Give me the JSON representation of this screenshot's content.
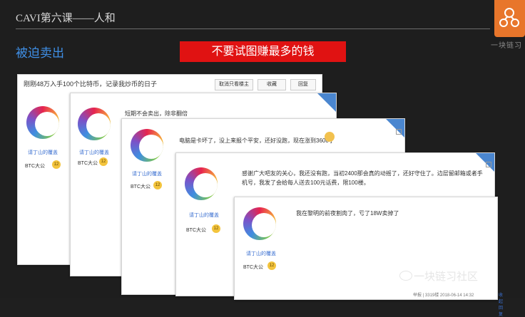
{
  "header": {
    "title": "CAVI第六课——人和",
    "subtitle": "被迫卖出",
    "banner": "不要试图赚最多的钱",
    "logo_text": "一块链习"
  },
  "card1": {
    "title": "刚刚48万入手100个比特币，记录我炒币的日子",
    "buttons": [
      "取消只看楼主",
      "收藏",
      "回复"
    ],
    "user": "请丁山的覆盖",
    "tag": "BTC大公",
    "level": "12"
  },
  "card2": {
    "post": "短期不会卖出，除非翻倍",
    "user": "请丁山的覆盖",
    "tag": "BTC大公",
    "level": "12"
  },
  "card3": {
    "post": "电脑是卡坏了，没上来报个平安，还好没跑，现在涨到3600了",
    "user": "请丁山的覆盖",
    "tag": "BTC大公",
    "level": "12"
  },
  "card4": {
    "post": "感谢广大吧友的关心，我还没有跑，当初2400那会真的动摇了，还好守住了。边层留邮箱或者手机号，我发了会给每人送去100元话费，限100楼。",
    "user": "请丁山的覆盖",
    "tag": "BTC大公",
    "level": "12"
  },
  "card5": {
    "post": "我在黎明的前夜割肉了，亏了18W卖掉了",
    "user": "请丁山的覆盖",
    "tag": "BTC大公",
    "level": "12",
    "footer": "举报 | 3319楼  2018-06-14 14:32",
    "footer_link": "收起回复"
  },
  "watermark": {
    "text": "一块链习社区"
  },
  "colors": {
    "accent_blue": "#3f8fe6",
    "banner_red": "#e01212",
    "logo_orange": "#e8762b"
  }
}
